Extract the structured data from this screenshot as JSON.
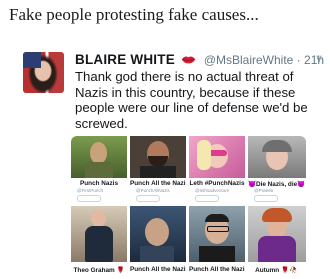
{
  "caption": "Fake people protesting fake causes...",
  "tweet": {
    "name": "BLAIRE WHITE",
    "emoji_icon": "lips-icon",
    "handle": "@MsBlaireWhite",
    "separator": " · ",
    "time": "21h",
    "chevron": "∨",
    "text": "Thank god there is no actual threat of Nazis in this country, because if these people were our line of defense we'd be screwed."
  },
  "cards": [
    {
      "name": "Punch Nazis",
      "handle": "@FirstPunch"
    },
    {
      "name": "Punch All the Nazis",
      "handle": "@PunchAllNazis"
    },
    {
      "name": "Leth #PunchNazis",
      "handle": "@lethsadventure"
    },
    {
      "name": "😈Die Nazis, die😈",
      "handle": "@Prae66"
    },
    {
      "name": "Theo Graham 🌹",
      "handle": "@theograham"
    },
    {
      "name": "Punch All the Nazis",
      "handle": "@PunchNazis"
    },
    {
      "name": "Punch All the Nazis",
      "handle": "@PunchAllTheN"
    },
    {
      "name": "Autumn 🌹🥀",
      "handle": "@AutumnYLC"
    }
  ]
}
